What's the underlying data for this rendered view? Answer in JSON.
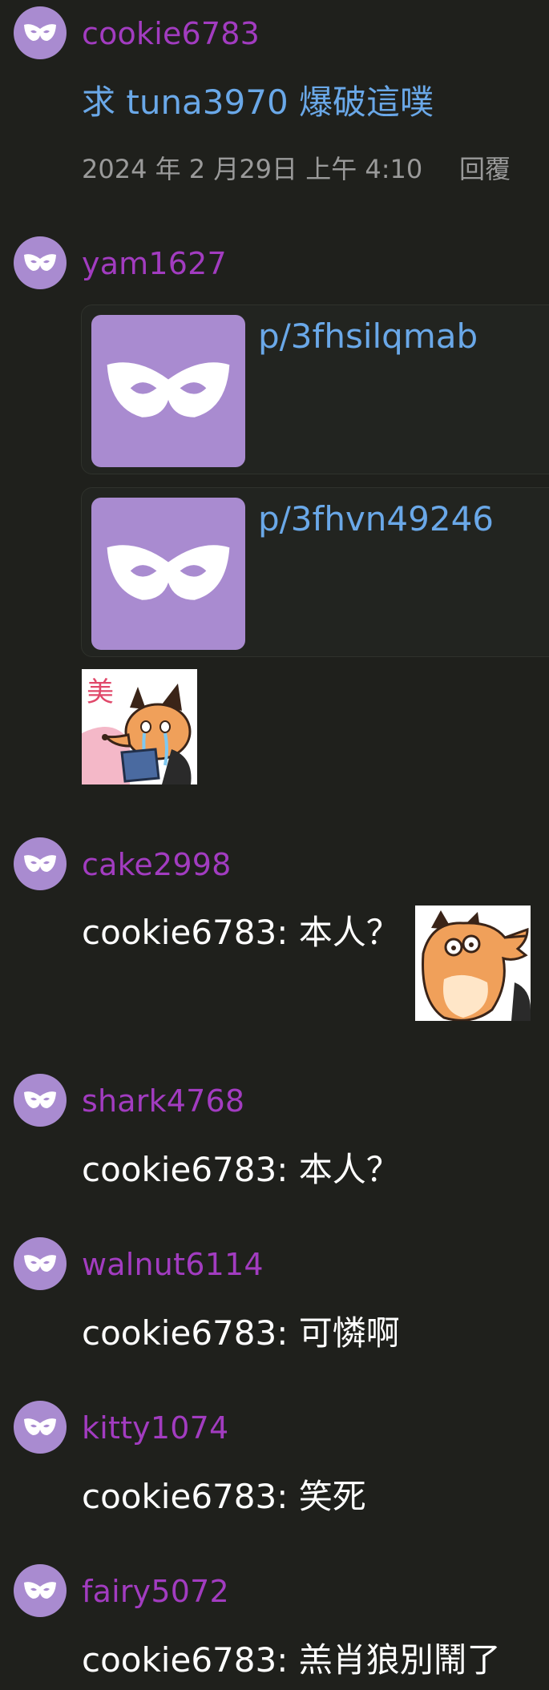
{
  "comments": [
    {
      "username": "cookie6783",
      "text": "求 tuna3970 爆破這噗",
      "timestamp": "2024 年 2 月29日 上午 4:10",
      "reply_label": "回覆"
    },
    {
      "username": "yam1627",
      "links": [
        {
          "title": "p/3fhsilqmab"
        },
        {
          "title": "p/3fhvn49246"
        }
      ],
      "sticker": "crying-fox-sticker"
    },
    {
      "username": "cake2998",
      "text": "cookie6783: 本人？",
      "sticker": "shocked-fox-sticker"
    },
    {
      "username": "shark4768",
      "text": "cookie6783: 本人？"
    },
    {
      "username": "walnut6114",
      "text": "cookie6783: 可憐啊"
    },
    {
      "username": "kitty1074",
      "text": "cookie6783: 笑死"
    },
    {
      "username": "fairy5072",
      "text": "cookie6783: 羔肖狼別鬧了"
    }
  ],
  "colors": {
    "background": "#1f201c",
    "username": "#a23cc0",
    "link": "#6aa8e8",
    "avatar": "#a98bd0",
    "meta": "#9a9a9a"
  },
  "icons": {
    "avatar": "mask-icon",
    "link_thumb": "mask-icon"
  }
}
